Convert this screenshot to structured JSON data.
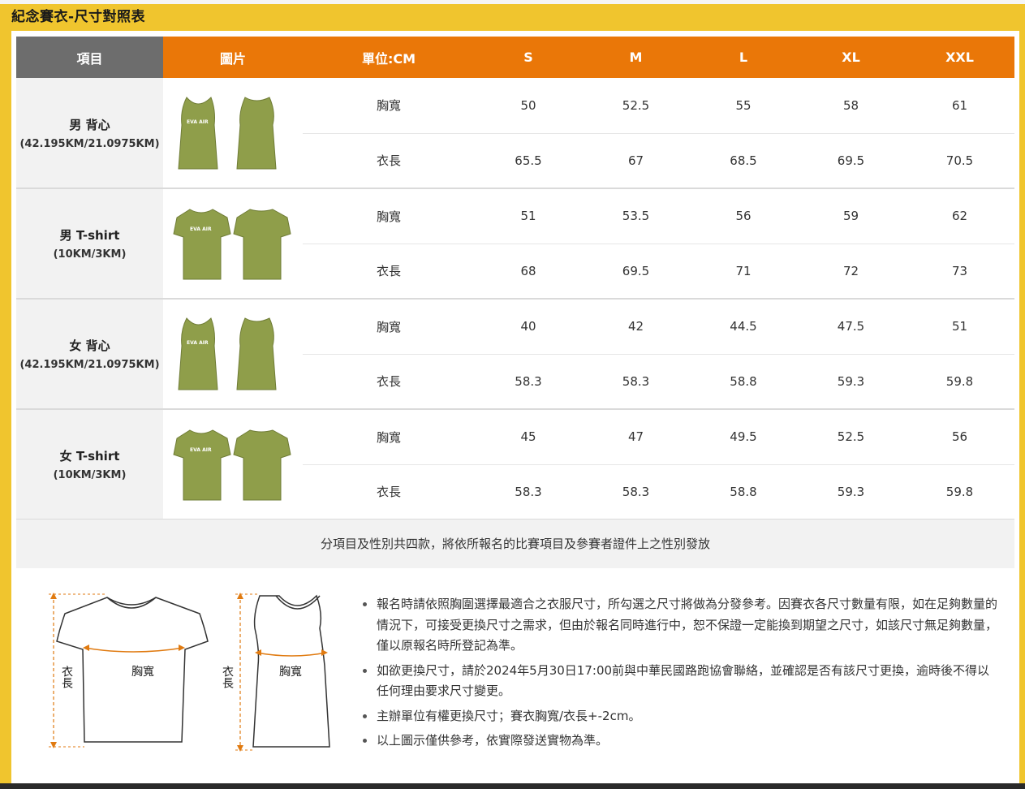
{
  "page_title": "紀念賽衣-尺寸對照表",
  "table": {
    "headers": {
      "item": "項目",
      "image": "圖片",
      "unit": "單位:CM",
      "sizes": [
        "S",
        "M",
        "L",
        "XL",
        "XXL"
      ]
    },
    "logo_text": "EVA AIR",
    "rows": [
      {
        "name": "男 背心",
        "distance": "(42.195KM/21.0975KM)",
        "type": "vest",
        "measures": [
          {
            "label": "胸寬",
            "values": [
              "50",
              "52.5",
              "55",
              "58",
              "61"
            ]
          },
          {
            "label": "衣長",
            "values": [
              "65.5",
              "67",
              "68.5",
              "69.5",
              "70.5"
            ]
          }
        ]
      },
      {
        "name": "男 T-shirt",
        "distance": "(10KM/3KM)",
        "type": "tee",
        "measures": [
          {
            "label": "胸寬",
            "values": [
              "51",
              "53.5",
              "56",
              "59",
              "62"
            ]
          },
          {
            "label": "衣長",
            "values": [
              "68",
              "69.5",
              "71",
              "72",
              "73"
            ]
          }
        ]
      },
      {
        "name": "女 背心",
        "distance": "(42.195KM/21.0975KM)",
        "type": "vest",
        "measures": [
          {
            "label": "胸寬",
            "values": [
              "40",
              "42",
              "44.5",
              "47.5",
              "51"
            ]
          },
          {
            "label": "衣長",
            "values": [
              "58.3",
              "58.3",
              "58.8",
              "59.3",
              "59.8"
            ]
          }
        ]
      },
      {
        "name": "女 T-shirt",
        "distance": "(10KM/3KM)",
        "type": "tee",
        "measures": [
          {
            "label": "胸寬",
            "values": [
              "45",
              "47",
              "49.5",
              "52.5",
              "56"
            ]
          },
          {
            "label": "衣長",
            "values": [
              "58.3",
              "58.3",
              "58.8",
              "59.3",
              "59.8"
            ]
          }
        ]
      }
    ]
  },
  "table_note": "分項目及性別共四款，將依所報名的比賽項目及參賽者證件上之性別發放",
  "diagram": {
    "length_label": "衣長",
    "chest_label": "胸寬"
  },
  "notes": [
    "報名時請依照胸圍選擇最適合之衣服尺寸，所勾選之尺寸將做為分發參考。因賽衣各尺寸數量有限，如在足夠數量的情況下，可接受更換尺寸之需求，但由於報名同時進行中，恕不保證一定能換到期望之尺寸，如該尺寸無足夠數量，僅以原報名時所登記為準。",
    "如欲更換尺寸，請於2024年5月30日17:00前與中華民國路跑協會聯絡，並確認是否有該尺寸更換，逾時後不得以任何理由要求尺寸變更。",
    "主辦單位有權更換尺寸；賽衣胸寬/衣長+-2cm。",
    "以上圖示僅供參考，依實際發送實物為準。"
  ],
  "colors": {
    "background": "#f0c52e",
    "header_orange": "#ea7708",
    "header_gray": "#6d6d6d",
    "jersey_olive": "#8f9e4a"
  }
}
